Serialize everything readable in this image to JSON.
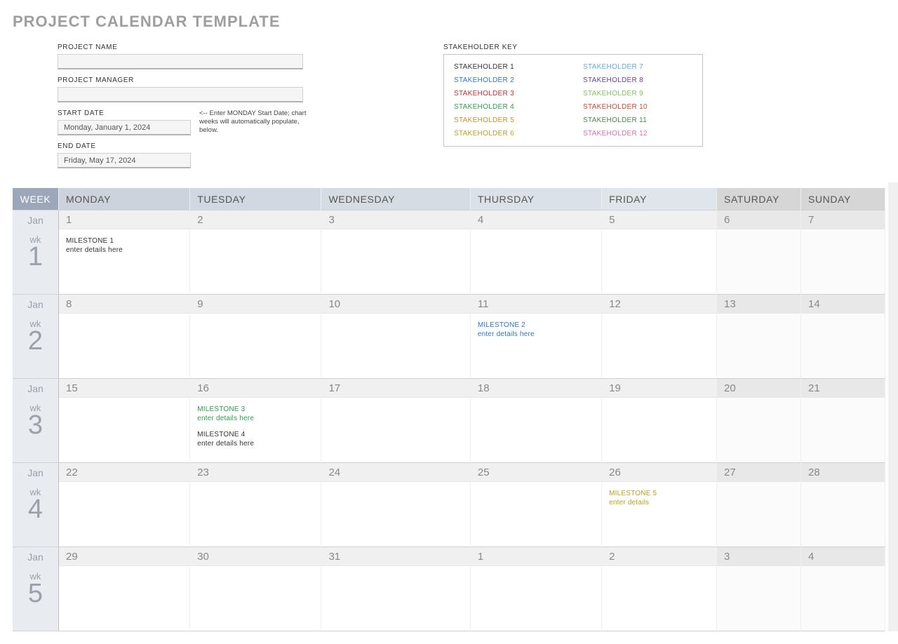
{
  "title": "PROJECT CALENDAR TEMPLATE",
  "fields": {
    "project_name_label": "PROJECT NAME",
    "project_name_value": "",
    "project_manager_label": "PROJECT MANAGER",
    "project_manager_value": "",
    "start_date_label": "START DATE",
    "start_date_value": "Monday, January 1, 2024",
    "end_date_label": "END DATE",
    "end_date_value": "Friday, May 17, 2024",
    "hint": "<-- Enter MONDAY Start Date; chart weeks will automatically populate, below."
  },
  "stakeholder_key_label": "STAKEHOLDER KEY",
  "stakeholders": [
    {
      "label": "STAKEHOLDER 1",
      "color": "#333333"
    },
    {
      "label": "STAKEHOLDER 2",
      "color": "#2b78c5"
    },
    {
      "label": "STAKEHOLDER 3",
      "color": "#c53030"
    },
    {
      "label": "STAKEHOLDER 4",
      "color": "#2e9e4f"
    },
    {
      "label": "STAKEHOLDER 5",
      "color": "#d58a2b"
    },
    {
      "label": "STAKEHOLDER 6",
      "color": "#b8a21b"
    },
    {
      "label": "STAKEHOLDER 7",
      "color": "#5ab0e0"
    },
    {
      "label": "STAKEHOLDER 8",
      "color": "#6a3ea1"
    },
    {
      "label": "STAKEHOLDER 9",
      "color": "#86c15c"
    },
    {
      "label": "STAKEHOLDER 10",
      "color": "#d24a2b"
    },
    {
      "label": "STAKEHOLDER 11",
      "color": "#4a8a4a"
    },
    {
      "label": "STAKEHOLDER 12",
      "color": "#e06bb0"
    }
  ],
  "headers": {
    "week": "WEEK",
    "days": [
      "MONDAY",
      "TUESDAY",
      "WEDNESDAY",
      "THURSDAY",
      "FRIDAY",
      "SATURDAY",
      "SUNDAY"
    ]
  },
  "weeks": [
    {
      "month": "Jan",
      "wk_label": "wk",
      "num": "1",
      "days": [
        {
          "n": "1",
          "milestones": [
            {
              "title": "MILESTONE 1",
              "detail": "enter details here",
              "color": "#333333"
            }
          ]
        },
        {
          "n": "2"
        },
        {
          "n": "3"
        },
        {
          "n": "4"
        },
        {
          "n": "5"
        },
        {
          "n": "6"
        },
        {
          "n": "7"
        }
      ]
    },
    {
      "month": "Jan",
      "wk_label": "wk",
      "num": "2",
      "days": [
        {
          "n": "8"
        },
        {
          "n": "9"
        },
        {
          "n": "10"
        },
        {
          "n": "11",
          "milestones": [
            {
              "title": "MILESTONE 2",
              "detail": "enter details here",
              "color": "#2b78c5"
            }
          ]
        },
        {
          "n": "12"
        },
        {
          "n": "13"
        },
        {
          "n": "14"
        }
      ]
    },
    {
      "month": "Jan",
      "wk_label": "wk",
      "num": "3",
      "days": [
        {
          "n": "15"
        },
        {
          "n": "16",
          "milestones": [
            {
              "title": "MILESTONE 3",
              "detail": "enter details here",
              "color": "#2e9e4f"
            },
            {
              "title": "MILESTONE 4",
              "detail": "enter details here",
              "color": "#333333"
            }
          ]
        },
        {
          "n": "17"
        },
        {
          "n": "18"
        },
        {
          "n": "19"
        },
        {
          "n": "20"
        },
        {
          "n": "21"
        }
      ]
    },
    {
      "month": "Jan",
      "wk_label": "wk",
      "num": "4",
      "days": [
        {
          "n": "22"
        },
        {
          "n": "23"
        },
        {
          "n": "24"
        },
        {
          "n": "25"
        },
        {
          "n": "26",
          "milestones": [
            {
              "title": "MILESTONE 5",
              "detail": "enter details",
              "color": "#b8a21b"
            }
          ]
        },
        {
          "n": "27"
        },
        {
          "n": "28"
        }
      ]
    },
    {
      "month": "Jan",
      "wk_label": "wk",
      "num": "5",
      "days": [
        {
          "n": "29"
        },
        {
          "n": "30"
        },
        {
          "n": "31"
        },
        {
          "n": "1"
        },
        {
          "n": "2"
        },
        {
          "n": "3"
        },
        {
          "n": "4"
        }
      ]
    }
  ]
}
